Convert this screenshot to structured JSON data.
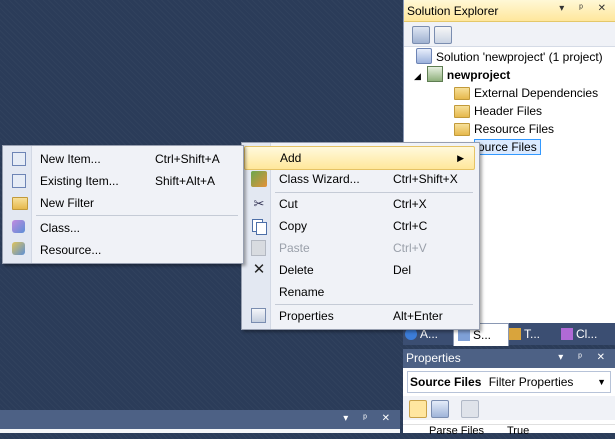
{
  "solution_explorer": {
    "title": "Solution Explorer",
    "title_buttons": "▾ ᵖ ✕",
    "tree": {
      "solution": "Solution 'newproject' (1 project)",
      "project": "newproject",
      "items": [
        "External Dependencies",
        "Header Files",
        "Resource Files",
        "Source Files"
      ],
      "selected_partial": "ource Files"
    },
    "tabs": [
      "A...",
      "S...",
      "T...",
      "Cl..."
    ]
  },
  "properties": {
    "title": "Properties",
    "title_buttons": "▾ ᵖ ✕",
    "combo_object": "Source Files",
    "combo_type": "Filter Properties",
    "row_name": "Parse Files",
    "row_value": "True"
  },
  "bottom_panel": {
    "title_buttons": "▾ ᵖ ✕"
  },
  "context_menu": {
    "items": [
      {
        "label": "Add",
        "shortcut": "",
        "submenu": true,
        "icon": ""
      },
      {
        "label": "Class Wizard...",
        "shortcut": "Ctrl+Shift+X",
        "icon": "class-wizard-icon"
      },
      {
        "label": "Cut",
        "shortcut": "Ctrl+X",
        "icon": "scissors-icon"
      },
      {
        "label": "Copy",
        "shortcut": "Ctrl+C",
        "icon": "copy-icon"
      },
      {
        "label": "Paste",
        "shortcut": "Ctrl+V",
        "icon": "paste-icon",
        "disabled": true
      },
      {
        "label": "Delete",
        "shortcut": "Del",
        "icon": "delete-icon"
      },
      {
        "label": "Rename",
        "shortcut": "",
        "icon": ""
      },
      {
        "label": "Properties",
        "shortcut": "Alt+Enter",
        "icon": "properties-icon"
      }
    ]
  },
  "add_submenu": {
    "items": [
      {
        "label": "New Item...",
        "shortcut": "Ctrl+Shift+A",
        "icon": "new-item-icon"
      },
      {
        "label": "Existing Item...",
        "shortcut": "Shift+Alt+A",
        "icon": "existing-item-icon"
      },
      {
        "label": "New Filter",
        "shortcut": "",
        "icon": "folder-icon"
      },
      {
        "label": "Class...",
        "shortcut": "",
        "icon": "class-icon"
      },
      {
        "label": "Resource...",
        "shortcut": "",
        "icon": "resource-icon"
      }
    ]
  }
}
